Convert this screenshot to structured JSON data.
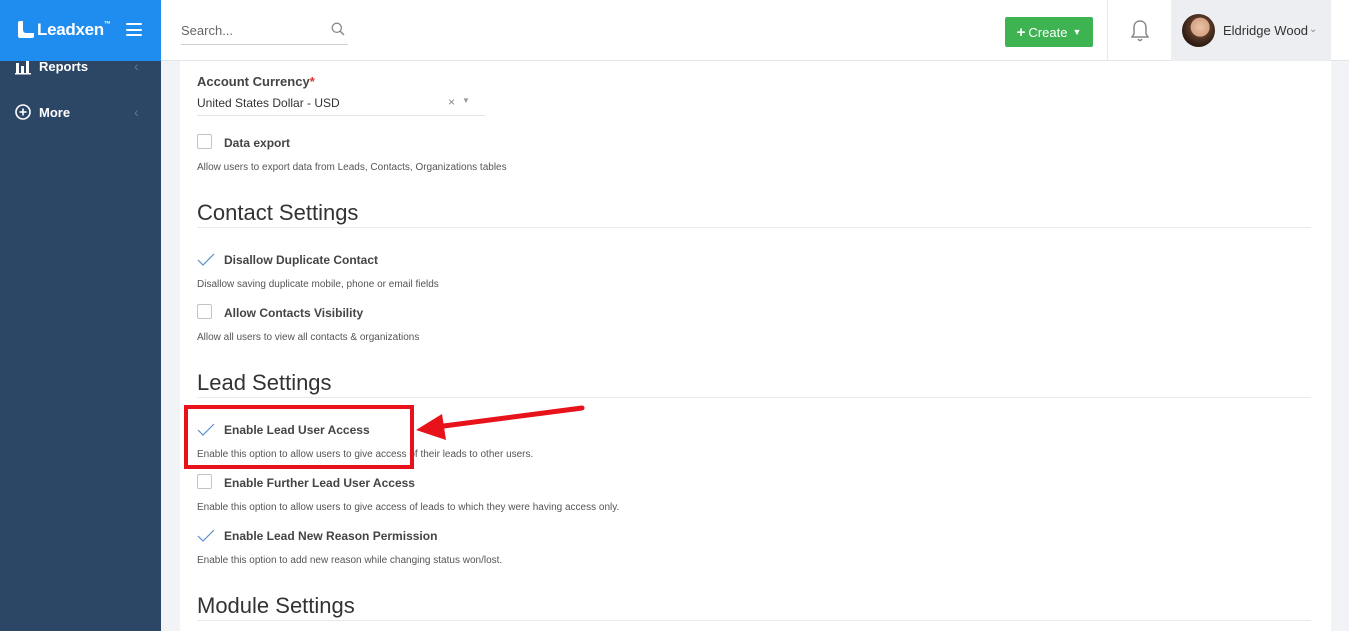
{
  "brand": {
    "name": "Leadxen",
    "tm": "™"
  },
  "sidebar": {
    "items": [
      {
        "label": "Reports",
        "icon": "bar-chart-icon"
      },
      {
        "label": "More",
        "icon": "plus-circle-icon"
      }
    ]
  },
  "topbar": {
    "search_placeholder": "Search...",
    "create_label": "Create",
    "user_name": "Eldridge Wood"
  },
  "form": {
    "currency_label": "Account Currency",
    "currency_required": "*",
    "currency_value": "United States Dollar - USD",
    "currency_clear": "×",
    "data_export_label": "Data export",
    "data_export_desc": "Allow users to export data from Leads, Contacts, Organizations tables"
  },
  "contact_settings": {
    "title": "Contact Settings",
    "options": [
      {
        "label": "Disallow Duplicate Contact",
        "desc": "Disallow saving duplicate mobile, phone or email fields",
        "checked": true
      },
      {
        "label": "Allow Contacts Visibility",
        "desc": "Allow all users to view all contacts & organizations",
        "checked": false
      }
    ]
  },
  "lead_settings": {
    "title": "Lead Settings",
    "options": [
      {
        "label": "Enable Lead User Access",
        "desc": "Enable this option to allow users to give access of their leads to other users.",
        "checked": true
      },
      {
        "label": "Enable Further Lead User Access",
        "desc": "Enable this option to allow users to give access of leads to which they were having access only.",
        "checked": false
      },
      {
        "label": "Enable Lead New Reason Permission",
        "desc": "Enable this option to add new reason while changing status won/lost.",
        "checked": true
      }
    ]
  },
  "module_settings": {
    "title": "Module Settings"
  },
  "colors": {
    "sidebar": "#2c4666",
    "brand": "#1f8df0",
    "create_button": "#3db351",
    "annotation": "#e8121a",
    "checkmark": "#5b8fc9"
  }
}
